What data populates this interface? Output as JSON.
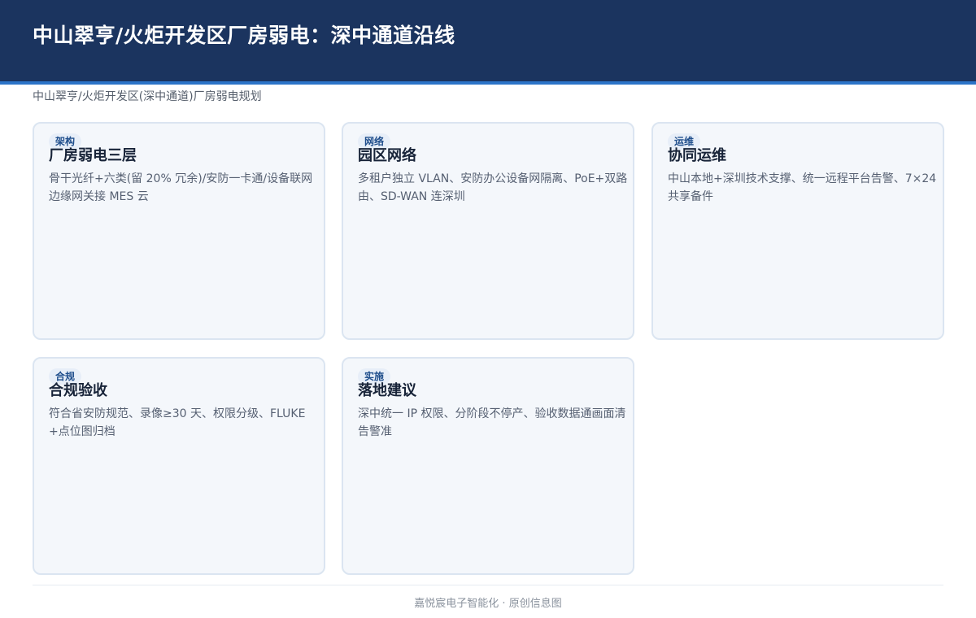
{
  "header": {
    "title": "中山翠亨/火炬开发区厂房弱电：深中通道沿线"
  },
  "subtitle": "中山翠亨/火炬开发区(深中通道)厂房弱电规划",
  "cards": [
    {
      "tag": "架构",
      "title": "厂房弱电三层",
      "desc": "骨干光纤+六类(留 20% 冗余)/安防一卡通/设备联网边缘网关接 MES 云"
    },
    {
      "tag": "网络",
      "title": "园区网络",
      "desc": "多租户独立 VLAN、安防办公设备网隔离、PoE+双路由、SD-WAN 连深圳"
    },
    {
      "tag": "运维",
      "title": "协同运维",
      "desc": "中山本地+深圳技术支撑、统一远程平台告警、7×24 共享备件"
    },
    {
      "tag": "合规",
      "title": "合规验收",
      "desc": "符合省安防规范、录像≥30 天、权限分级、FLUKE+点位图归档"
    },
    {
      "tag": "实施",
      "title": "落地建议",
      "desc": "深中统一 IP 权限、分阶段不停产、验收数据通画面清告警准"
    }
  ],
  "footer": "嘉悦宸电子智能化 · 原创信息图"
}
